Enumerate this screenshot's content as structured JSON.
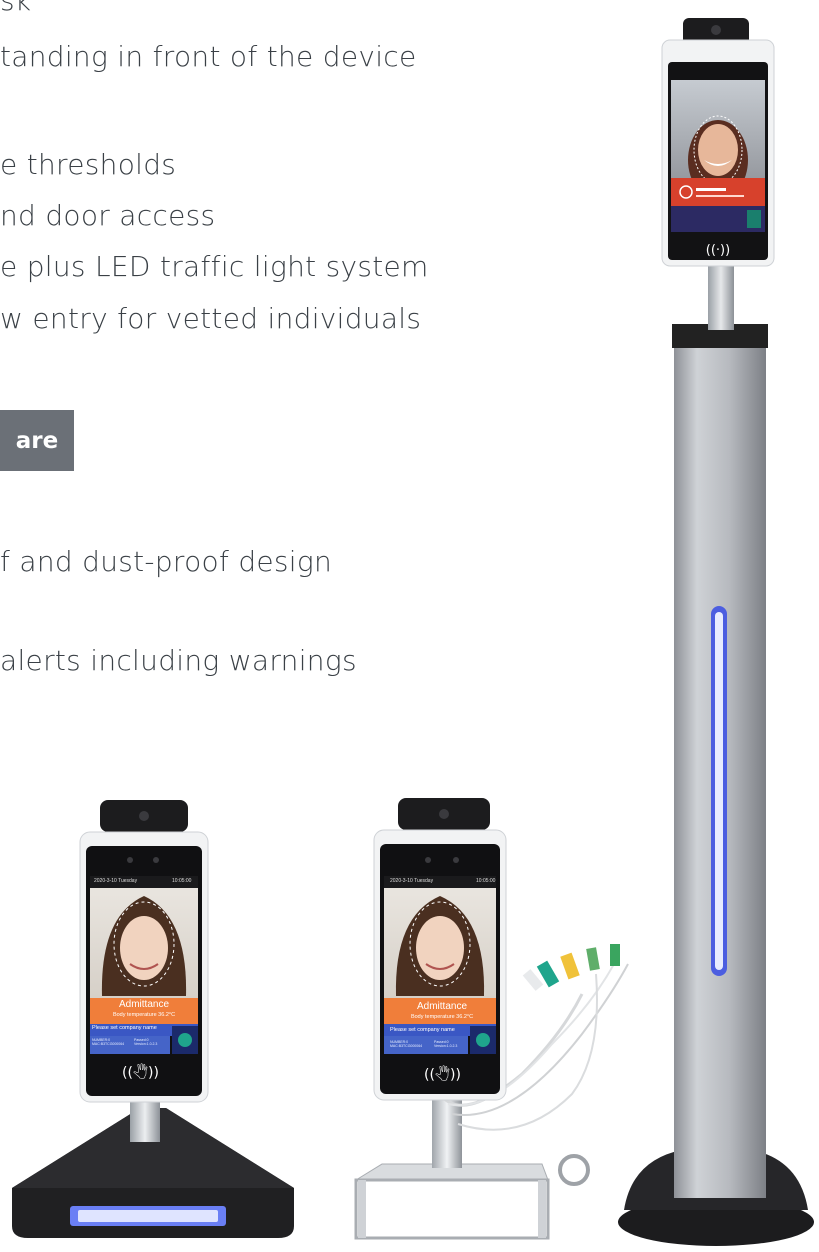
{
  "features": [
    "sk",
    "tanding in front of the device",
    "e thresholds",
    "nd door access",
    "e plus LED traffic light system",
    "w entry for vetted individuals",
    "f and dust-proof design",
    "alerts including warnings"
  ],
  "section_label": "are",
  "device_screen": {
    "date": "2020-3-10  Tuesday",
    "time": "10:05:00",
    "status": "Admittance",
    "temperature": "Body temperature 36.2°C",
    "company_prompt": "Please set company name",
    "info_left": "NUMBER:0\nMAC:B3TCG000064",
    "info_right": "Passed:0\nVersion:1.0.2.3",
    "nfc_symbol": "((🖑))"
  },
  "colors": {
    "accent_orange": "#f07e3a",
    "info_blue": "#4564c8",
    "led_blue": "#6a7ff5",
    "pole_silver": "#b9bcc1"
  }
}
